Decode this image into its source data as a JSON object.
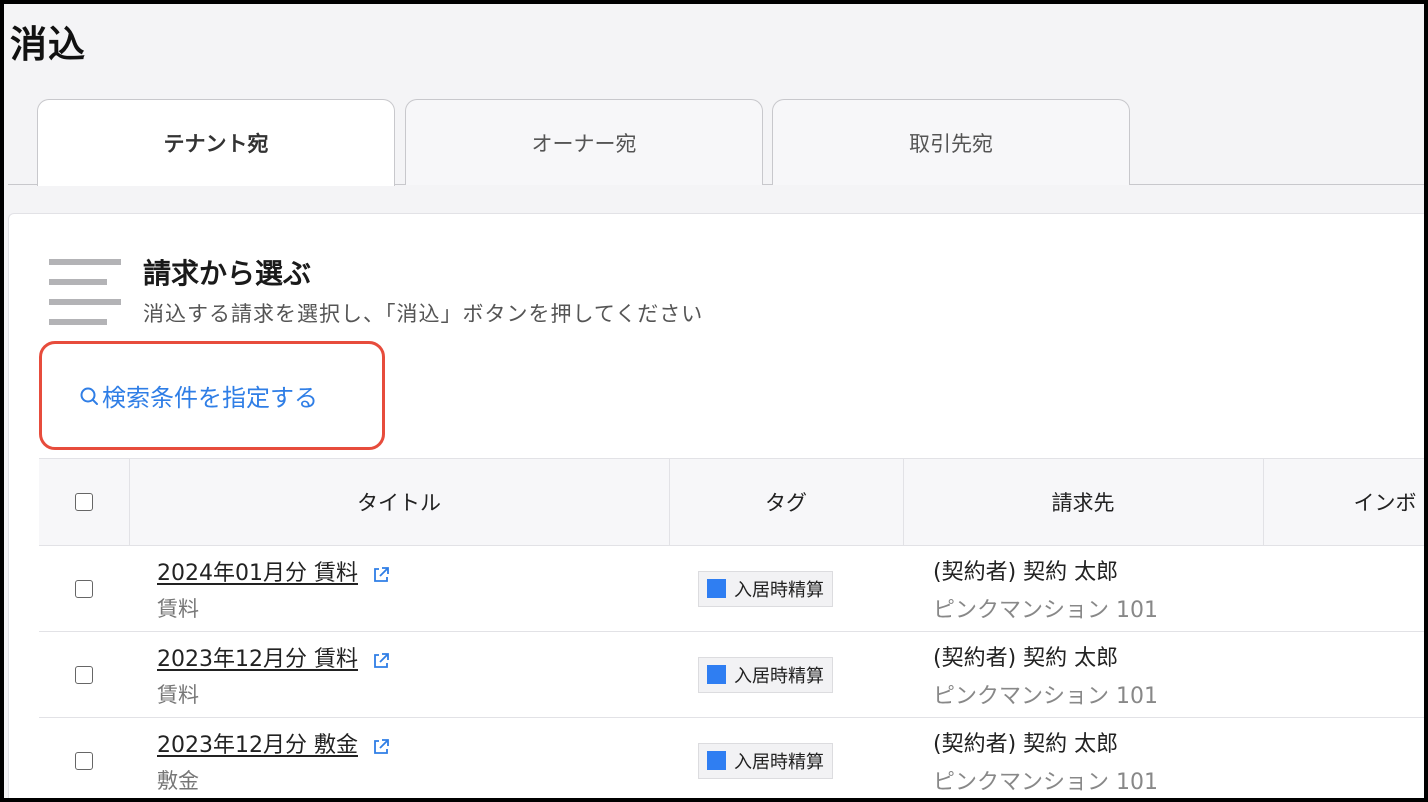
{
  "page": {
    "title": "消込"
  },
  "tabs": [
    {
      "label": "テナント宛",
      "active": true
    },
    {
      "label": "オーナー宛",
      "active": false
    },
    {
      "label": "取引先宛",
      "active": false
    }
  ],
  "section": {
    "title": "請求から選ぶ",
    "description": "消込する請求を選択し、「消込」ボタンを押してください",
    "icon": "list-icon"
  },
  "search": {
    "label": "検索条件を指定する",
    "icon": "search-icon"
  },
  "table": {
    "columns": [
      "タイトル",
      "タグ",
      "請求先",
      "インボ"
    ],
    "rows": [
      {
        "title": "2024年01月分 賃料",
        "subtitle": "賃料",
        "tag": "入居時精算",
        "payer": "(契約者) 契約 太郎",
        "property": "ピンクマンション 101"
      },
      {
        "title": "2023年12月分 賃料",
        "subtitle": "賃料",
        "tag": "入居時精算",
        "payer": "(契約者) 契約 太郎",
        "property": "ピンクマンション 101"
      },
      {
        "title": "2023年12月分 敷金",
        "subtitle": "敷金",
        "tag": "入居時精算",
        "payer": "(契約者) 契約 太郎",
        "property": "ピンクマンション 101"
      }
    ]
  },
  "colors": {
    "accent": "#2f7ee6",
    "tag_swatch": "#2f7ef2",
    "highlight": "#e74c3c"
  }
}
